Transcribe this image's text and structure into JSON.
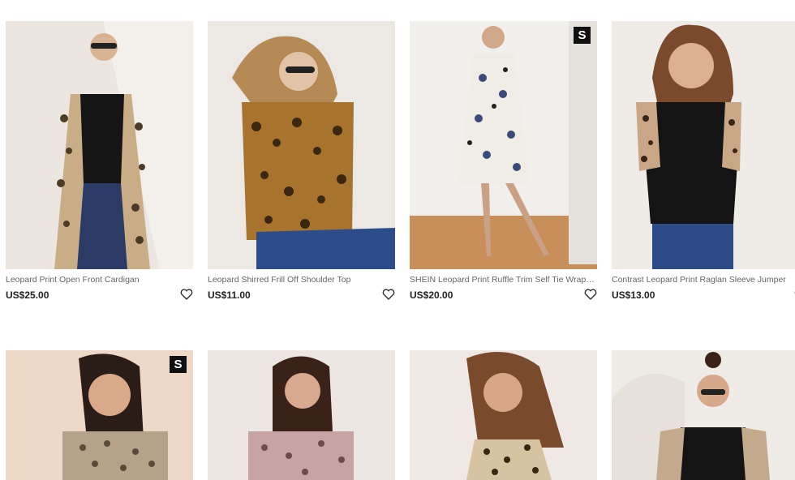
{
  "products": [
    {
      "title": "Leopard Print Open Front Cardigan",
      "price": "US$25.00",
      "badge": "",
      "icon": "heart-icon"
    },
    {
      "title": "Leopard Shirred Frill Off Shoulder Top",
      "price": "US$11.00",
      "badge": "",
      "icon": "heart-icon"
    },
    {
      "title": "SHEIN Leopard Print Ruffle Trim Self Tie Wrap…",
      "price": "US$20.00",
      "badge": "S",
      "icon": "heart-icon"
    },
    {
      "title": "Contrast Leopard Print Raglan Sleeve Jumper",
      "price": "US$13.00",
      "badge": "",
      "icon": "heart-icon"
    },
    {
      "title": "",
      "price": "",
      "badge": "S",
      "icon": ""
    },
    {
      "title": "",
      "price": "",
      "badge": "",
      "icon": ""
    },
    {
      "title": "",
      "price": "",
      "badge": "",
      "icon": ""
    },
    {
      "title": "",
      "price": "",
      "badge": "",
      "icon": ""
    }
  ],
  "colors": {
    "text": "#222222",
    "muted": "#666666",
    "badge_bg": "#111111"
  }
}
